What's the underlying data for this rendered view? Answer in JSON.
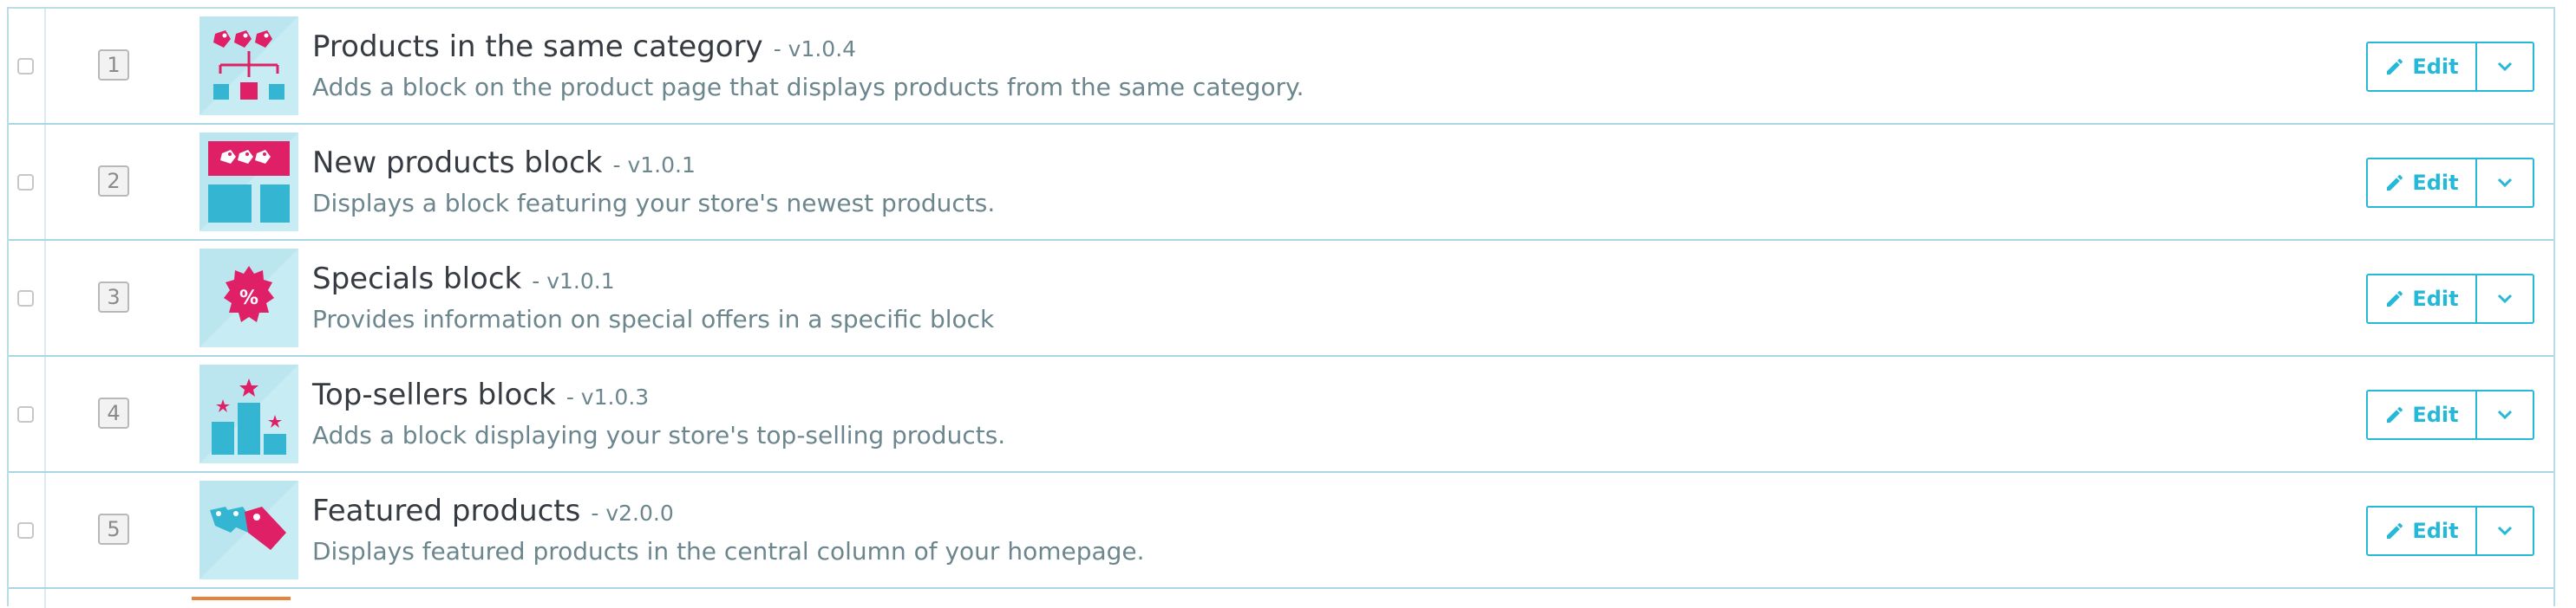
{
  "modules": [
    {
      "position": "1",
      "name": "Products in the same category",
      "version": "- v1.0.4",
      "description": "Adds a block on the product page that displays products from the same category.",
      "icon": "same-category-icon",
      "edit_label": "Edit"
    },
    {
      "position": "2",
      "name": "New products block",
      "version": "- v1.0.1",
      "description": "Displays a block featuring your store's newest products.",
      "icon": "new-products-icon",
      "edit_label": "Edit"
    },
    {
      "position": "3",
      "name": "Specials block",
      "version": "- v1.0.1",
      "description": "Provides information on special offers in a specific block",
      "icon": "percent-badge-icon",
      "edit_label": "Edit"
    },
    {
      "position": "4",
      "name": "Top-sellers block",
      "version": "- v1.0.3",
      "description": "Adds a block displaying your store's top-selling products.",
      "icon": "podium-icon",
      "edit_label": "Edit"
    },
    {
      "position": "5",
      "name": "Featured products",
      "version": "- v2.0.0",
      "description": "Displays featured products in the central column of your homepage.",
      "icon": "featured-tags-icon",
      "edit_label": "Edit"
    }
  ],
  "colors": {
    "accent": "#25b9d7",
    "brand_pink": "#df1f66",
    "icon_blue": "#34b6d3",
    "icon_bg": "#bce6ef"
  }
}
